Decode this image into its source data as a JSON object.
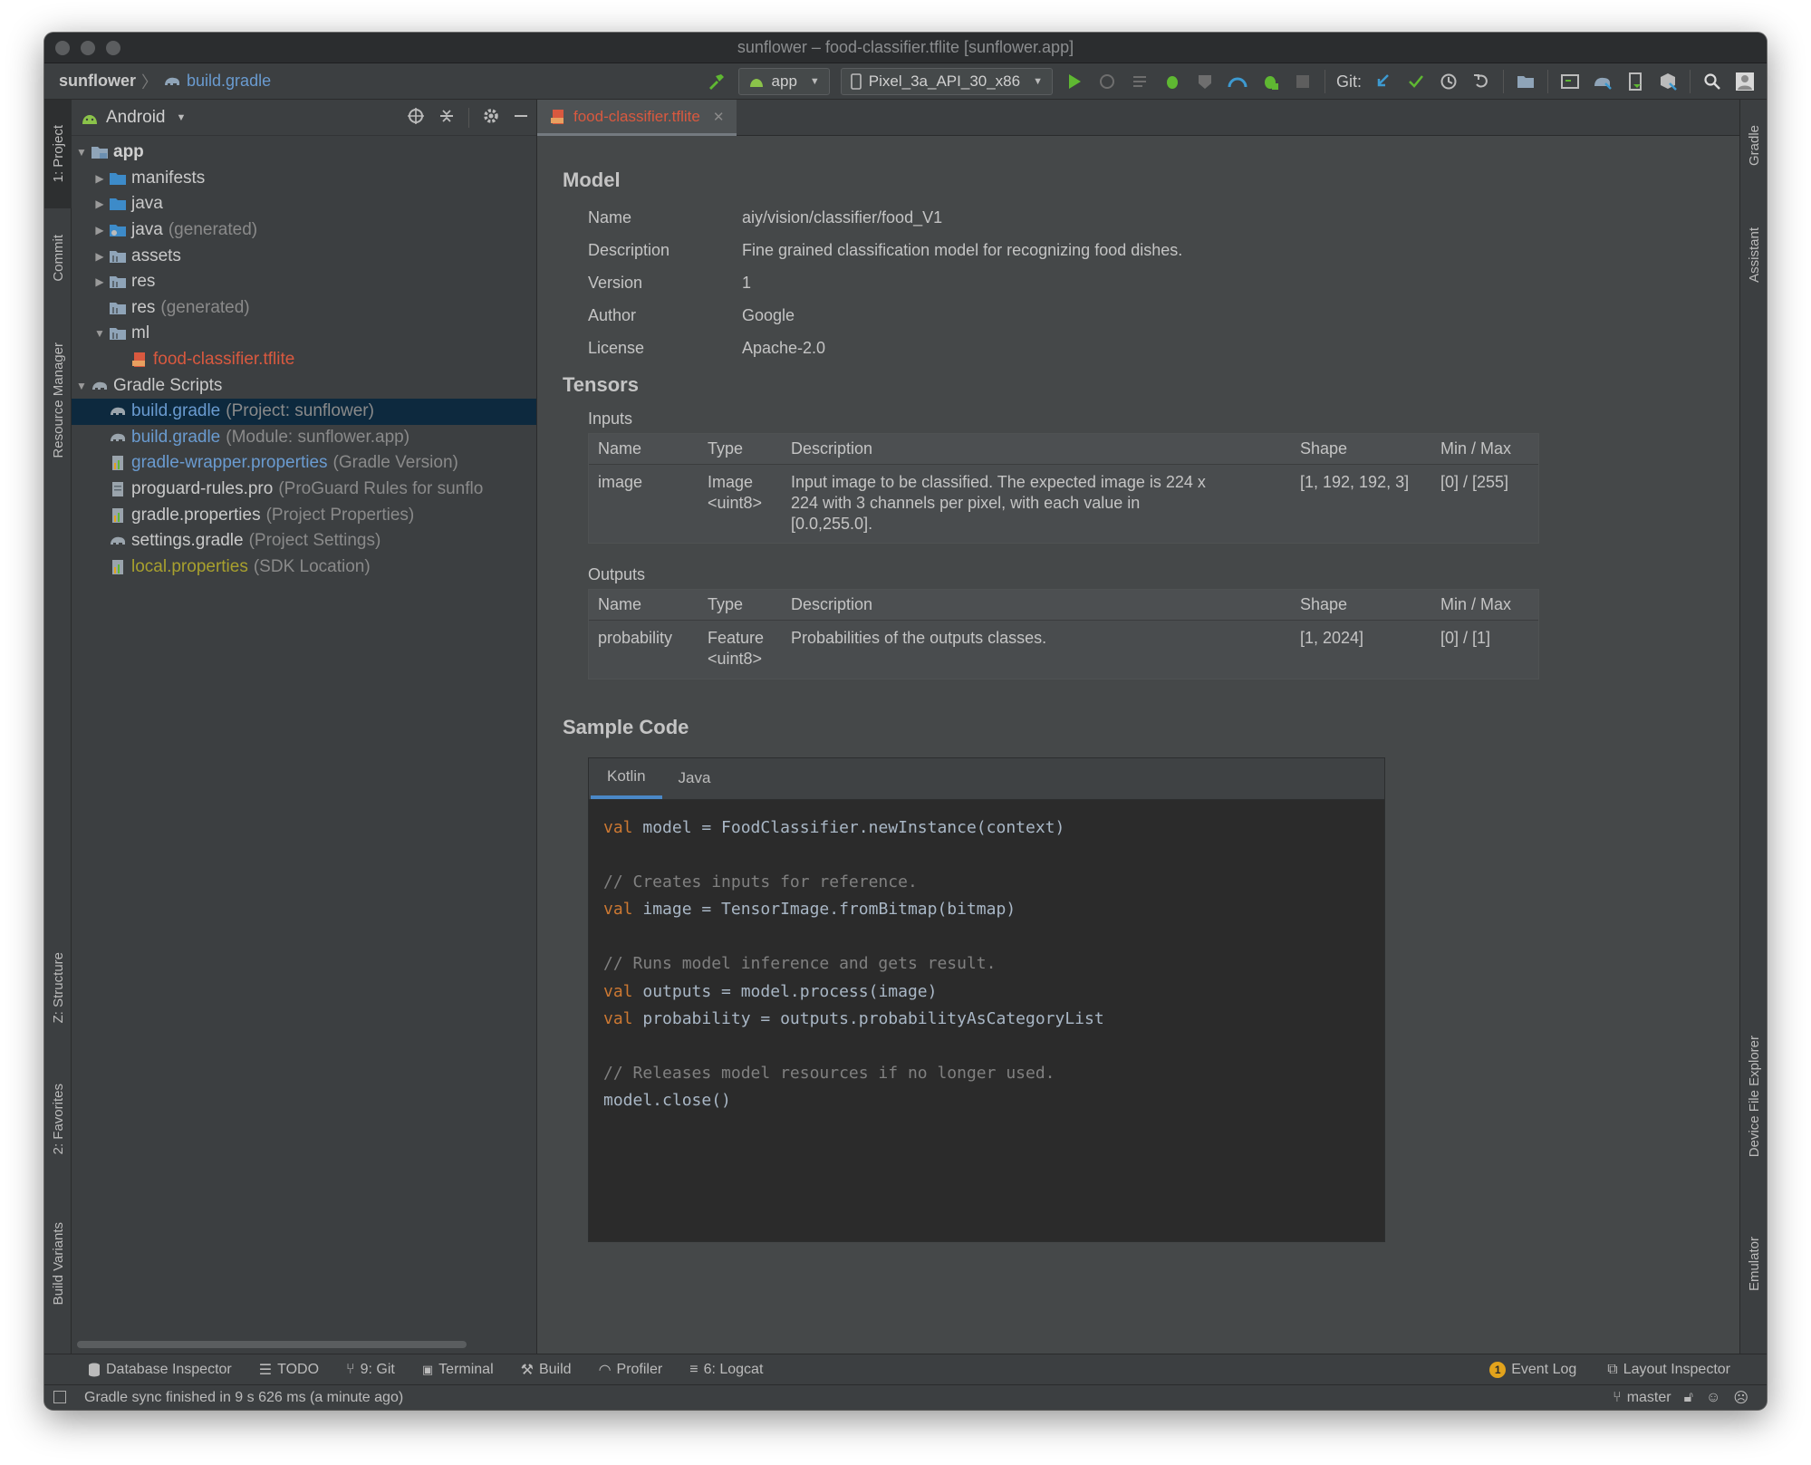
{
  "window": {
    "title": "sunflower – food-classifier.tflite [sunflower.app]"
  },
  "breadcrumb": {
    "project": "sunflower",
    "file": "build.gradle"
  },
  "toolbar": {
    "config": "app",
    "device": "Pixel_3a_API_30_x86",
    "git_label": "Git:"
  },
  "left_tabs": {
    "project": "1: Project",
    "commit": "Commit",
    "resource_manager": "Resource Manager",
    "structure": "Z: Structure",
    "favorites": "2: Favorites",
    "build_variants": "Build Variants"
  },
  "right_tabs": {
    "gradle": "Gradle",
    "assistant": "Assistant",
    "device_file_explorer": "Device File Explorer",
    "emulator": "Emulator"
  },
  "project_panel": {
    "view": "Android",
    "tree": [
      {
        "label": "app",
        "extra": ""
      },
      {
        "label": "manifests",
        "extra": ""
      },
      {
        "label": "java",
        "extra": ""
      },
      {
        "label": "java",
        "extra": "(generated)"
      },
      {
        "label": "assets",
        "extra": ""
      },
      {
        "label": "res",
        "extra": ""
      },
      {
        "label": "res",
        "extra": "(generated)"
      },
      {
        "label": "ml",
        "extra": ""
      },
      {
        "label": "food-classifier.tflite",
        "extra": ""
      },
      {
        "label": "Gradle Scripts",
        "extra": ""
      },
      {
        "label": "build.gradle",
        "extra": "(Project: sunflower)"
      },
      {
        "label": "build.gradle",
        "extra": "(Module: sunflower.app)"
      },
      {
        "label": "gradle-wrapper.properties",
        "extra": "(Gradle Version)"
      },
      {
        "label": "proguard-rules.pro",
        "extra": "(ProGuard Rules for sunflo"
      },
      {
        "label": "gradle.properties",
        "extra": "(Project Properties)"
      },
      {
        "label": "settings.gradle",
        "extra": "(Project Settings)"
      },
      {
        "label": "local.properties",
        "extra": "(SDK Location)"
      }
    ]
  },
  "editor": {
    "tab": "food-classifier.tflite",
    "model": {
      "heading": "Model",
      "fields": [
        {
          "label": "Name",
          "value": "aiy/vision/classifier/food_V1"
        },
        {
          "label": "Description",
          "value": "Fine grained classification model for recognizing food dishes."
        },
        {
          "label": "Version",
          "value": "1"
        },
        {
          "label": "Author",
          "value": "Google"
        },
        {
          "label": "License",
          "value": "Apache-2.0"
        }
      ]
    },
    "tensors": {
      "heading": "Tensors",
      "columns": [
        "Name",
        "Type",
        "Description",
        "Shape",
        "Min / Max"
      ],
      "inputs": {
        "label": "Inputs",
        "rows": [
          {
            "name": "image",
            "type_line1": "Image",
            "type_line2": "<uint8>",
            "desc_line1": "Input image to be classified. The expected image is 224 x",
            "desc_line2": "224 with 3 channels per pixel, with each value in",
            "desc_line3": "[0.0,255.0].",
            "shape": "[1, 192, 192, 3]",
            "minmax": "[0] / [255]"
          }
        ]
      },
      "outputs": {
        "label": "Outputs",
        "rows": [
          {
            "name": "probability",
            "type_line1": "Feature",
            "type_line2": "<uint8>",
            "desc_line1": "Probabilities of the outputs classes.",
            "shape": "[1, 2024]",
            "minmax": "[0] / [1]"
          }
        ]
      }
    },
    "sample_code": {
      "heading": "Sample Code",
      "tabs": [
        "Kotlin",
        "Java"
      ],
      "lines": [
        {
          "kw": "val",
          "text": " model = FoodClassifier.newInstance(context)",
          "cmt": ""
        },
        {
          "kw": "",
          "text": "",
          "cmt": ""
        },
        {
          "kw": "",
          "text": "",
          "cmt": "// Creates inputs for reference."
        },
        {
          "kw": "val",
          "text": " image = TensorImage.fromBitmap(bitmap)",
          "cmt": ""
        },
        {
          "kw": "",
          "text": "",
          "cmt": ""
        },
        {
          "kw": "",
          "text": "",
          "cmt": "// Runs model inference and gets result."
        },
        {
          "kw": "val",
          "text": " outputs = model.process(image)",
          "cmt": ""
        },
        {
          "kw": "val",
          "text": " probability = outputs.probabilityAsCategoryList",
          "cmt": ""
        },
        {
          "kw": "",
          "text": "",
          "cmt": ""
        },
        {
          "kw": "",
          "text": "",
          "cmt": "// Releases model resources if no longer used."
        },
        {
          "kw": "",
          "text": "model.close()",
          "cmt": ""
        }
      ]
    }
  },
  "bottom_tools": {
    "database_inspector": "Database Inspector",
    "todo": "TODO",
    "git": "9: Git",
    "terminal": "Terminal",
    "build": "Build",
    "profiler": "Profiler",
    "logcat": "6: Logcat",
    "event_log": "Event Log",
    "event_log_count": "1",
    "layout_inspector": "Layout Inspector"
  },
  "status": {
    "message": "Gradle sync finished in 9 s 626 ms (a minute ago)",
    "branch": "master"
  },
  "colors": {
    "background": "#3c3f41",
    "editor_bg": "#454849",
    "code_bg": "#2b2b2b",
    "keyword": "#cc7832",
    "comment": "#808080",
    "link_blue": "#6a9bd0",
    "tflite_red": "#d9593f",
    "selection": "#0d293e"
  }
}
